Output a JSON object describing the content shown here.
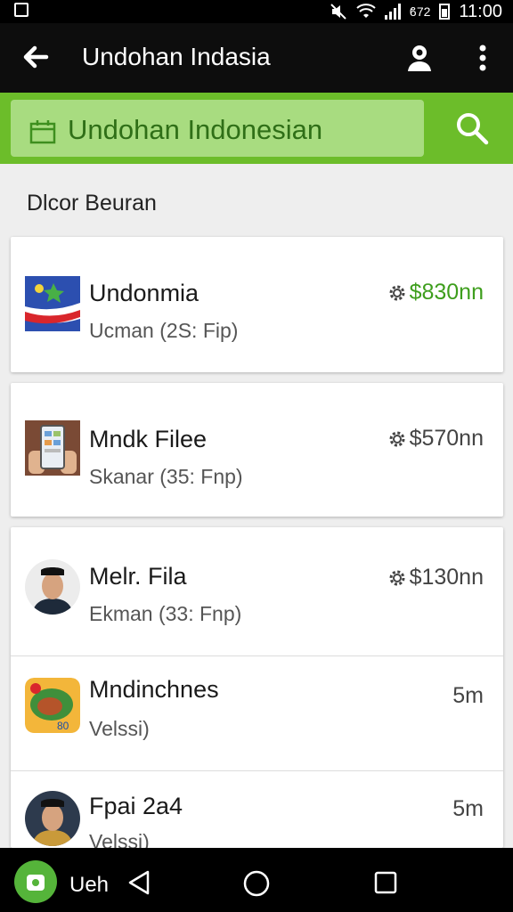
{
  "status_bar": {
    "battery_text": "ϐ72",
    "time": "11:00"
  },
  "app_bar": {
    "title": "Undohan Indasia",
    "back_icon": "arrow-left-icon",
    "profile_icon": "user-icon",
    "menu_icon": "more-vertical-icon"
  },
  "search": {
    "query": "Undohan Indonesian",
    "icon": "search-icon",
    "accent_color": "#6cbd2a"
  },
  "section": {
    "title": "Dlcor Beuran"
  },
  "items": [
    {
      "name": "Undonmia",
      "sub": "Ucman (2S: Fip)",
      "meta": "$830nn",
      "meta_color": "#3e9e1d"
    },
    {
      "name": "Mndk Filee",
      "sub": "Skanar (35: Fnp)",
      "meta": "$570nn",
      "meta_color": "#444444"
    },
    {
      "name": "Melr. Fila",
      "sub": "Ekman (33: Fnp)",
      "meta": "$130nn",
      "meta_color": "#444444"
    },
    {
      "name": "Mndinchnes",
      "sub": "Velssi)",
      "meta": "5m",
      "meta_color": "#444444"
    },
    {
      "name": "Fpai 2a4",
      "sub": "Velssi)",
      "meta": "5m",
      "meta_color": "#444444"
    }
  ],
  "nav_bar": {
    "app_label": "Ueh"
  }
}
